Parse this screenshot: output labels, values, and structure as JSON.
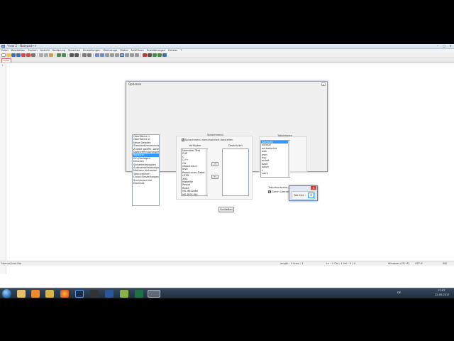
{
  "window": {
    "title": "*new 2 - Notepad++",
    "controls": [
      "–",
      "□",
      "×"
    ]
  },
  "menu": [
    "Datei",
    "Bearbeiten",
    "Suchen",
    "Ansicht",
    "Kodierung",
    "Sprachen",
    "Einstellungen",
    "Werkzeuge",
    "Makro",
    "Ausführen",
    "Erweiterungen",
    "Fenster",
    "?"
  ],
  "tab": {
    "label": "new 2"
  },
  "editor": {
    "line_number": "1"
  },
  "dialog": {
    "title": "Optionen",
    "close": "×",
    "categories": [
      "Oberfläche 1",
      "Oberfläche 2",
      "Neue Dateien",
      "Standardverzeichnis",
      "Zuletzt geöffn. Dateien",
      "Dateiverknüpfungen",
      "Sprache",
      "Ein-/Vorlagen",
      "Drucken",
      "Sicherheitskopien",
      "Autovervollständigung",
      "Mehrere Instanzen",
      "Trennzeichen",
      "Cloud-Einstellungen",
      "Suchmaschine",
      "Diverses"
    ],
    "selected_category": 6,
    "language_menu": {
      "group_label": "Sprachmenü",
      "compact_label": "Sprachmenü verschachtelt darstellen",
      "available_label": "Verfügbar",
      "disabled_label": "Deaktiviert",
      "available_items": [
        "Normaler Text",
        "PHP",
        "C",
        "C++",
        "C#",
        "Objective-C",
        "Java",
        "Ressourcen-Datei",
        "HTML",
        "XML",
        "Makefile",
        "Pascal",
        "Batch",
        "MS-INI-Datei",
        "MS-DOS-Stil"
      ],
      "move_right": "→",
      "move_left": "←"
    },
    "tab_settings": {
      "group_label": "Tabulatoren",
      "items": [
        "[Default]",
        "normal",
        "actionscript",
        "ada",
        "asm",
        "asp",
        "autoit",
        "bash",
        "batch",
        "c",
        "caml"
      ],
      "selected_item": 0,
      "width_label": "Tabulatorbreite : 4",
      "replace_label": "Durch Leerzeichen ersetzen"
    },
    "close_button": "Schließen"
  },
  "popup": {
    "close": "×",
    "label": "Tab-Size :",
    "value": "4"
  },
  "statusbar": {
    "file_type": "Normal text file",
    "length": "length : 0    lines : 1",
    "position": "Ln : 1    Col : 1    Sel : 0 | 0",
    "eol": "Windows (CR LF)",
    "encoding": "UTF-8",
    "mode": "INS"
  },
  "taskbar": {
    "apps": [
      "explorer",
      "mediaplayer",
      "firefox",
      "photoshop",
      "media-center",
      "word",
      "notepadpp",
      "excel",
      "notepadpp-active"
    ],
    "lang": "DE",
    "time": "17:07",
    "date": "22.05.2017"
  },
  "colors": {
    "accent_blue": "#3399ff",
    "taskbar": "#253648",
    "close_red": "#c9453a"
  }
}
